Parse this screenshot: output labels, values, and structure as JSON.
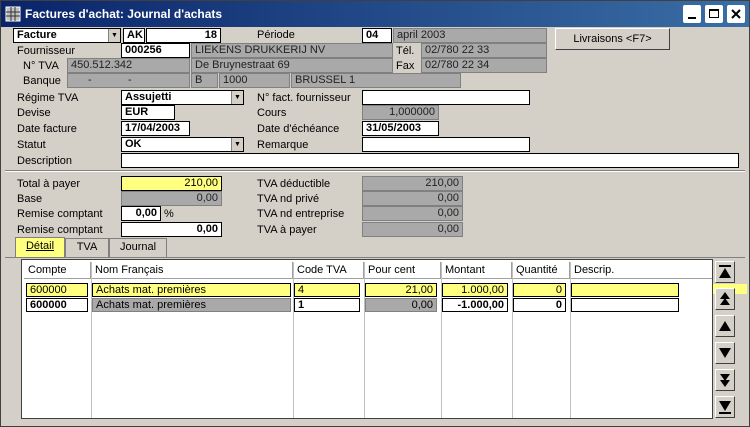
{
  "window": {
    "title": "Factures d'achat: Journal d'achats"
  },
  "header": {
    "doc_type": "Facture",
    "journal_code": "AK",
    "doc_number": "18",
    "periode_label": "Période",
    "periode_num": "04",
    "periode_text": "april 2003",
    "livraisons_button": "Livraisons <F7>"
  },
  "supplier": {
    "fournisseur_label": "Fournisseur",
    "code": "000256",
    "name": "LIEKENS DRUKKERIJ NV",
    "tel_label": "Tél.",
    "tel": "02/780 22 33",
    "tva_label": "N° TVA",
    "tva": "450.512.342",
    "street": "De Bruynestraat 69",
    "fax_label": "Fax",
    "fax": "02/780 22 34",
    "banque_label": "Banque",
    "banque_a": "-",
    "banque_b": "-",
    "country": "B",
    "postcode": "1000",
    "city": "BRUSSEL 1"
  },
  "details": {
    "regime_label": "Régime TVA",
    "regime": "Assujetti",
    "nfact_label": "N° fact. fournisseur",
    "nfact": "",
    "devise_label": "Devise",
    "devise": "EUR",
    "cours_label": "Cours",
    "cours": "1,000000",
    "date_facture_label": "Date facture",
    "date_facture": "17/04/2003",
    "date_echeance_label": "Date d'échéance",
    "date_echeance": "31/05/2003",
    "statut_label": "Statut",
    "statut": "OK",
    "remarque_label": "Remarque",
    "remarque": "",
    "description_label": "Description",
    "description": ""
  },
  "totals": {
    "total_label": "Total à payer",
    "total": "210,00",
    "base_label": "Base",
    "base": "0,00",
    "remise_pct_label": "Remise comptant",
    "remise_pct": "0,00",
    "pct_sign": "%",
    "remise_label": "Remise comptant",
    "remise": "0,00",
    "tva_deductible_label": "TVA déductible",
    "tva_deductible": "210,00",
    "tva_nd_prive_label": "TVA nd privé",
    "tva_nd_prive": "0,00",
    "tva_nd_entreprise_label": "TVA nd entreprise",
    "tva_nd_entreprise": "0,00",
    "tva_a_payer_label": "TVA à payer",
    "tva_a_payer": "0,00"
  },
  "tabs": [
    {
      "label": "Détail"
    },
    {
      "label": "TVA"
    },
    {
      "label": "Journal"
    }
  ],
  "grid": {
    "columns": [
      "Compte",
      "Nom Français",
      "Code TVA",
      "Pour cent",
      "Montant",
      "Quantité",
      "Descrip."
    ],
    "rows": [
      {
        "compte": "600000",
        "nom": "Achats mat. premières",
        "code_tva": "4",
        "pour_cent": "21,00",
        "montant": "1.000,00",
        "quantite": "0",
        "descrip": ""
      },
      {
        "compte": "600000",
        "nom": "Achats mat. premières",
        "code_tva": "1",
        "pour_cent": "0,00",
        "montant": "-1.000,00",
        "quantite": "0",
        "descrip": ""
      }
    ]
  }
}
